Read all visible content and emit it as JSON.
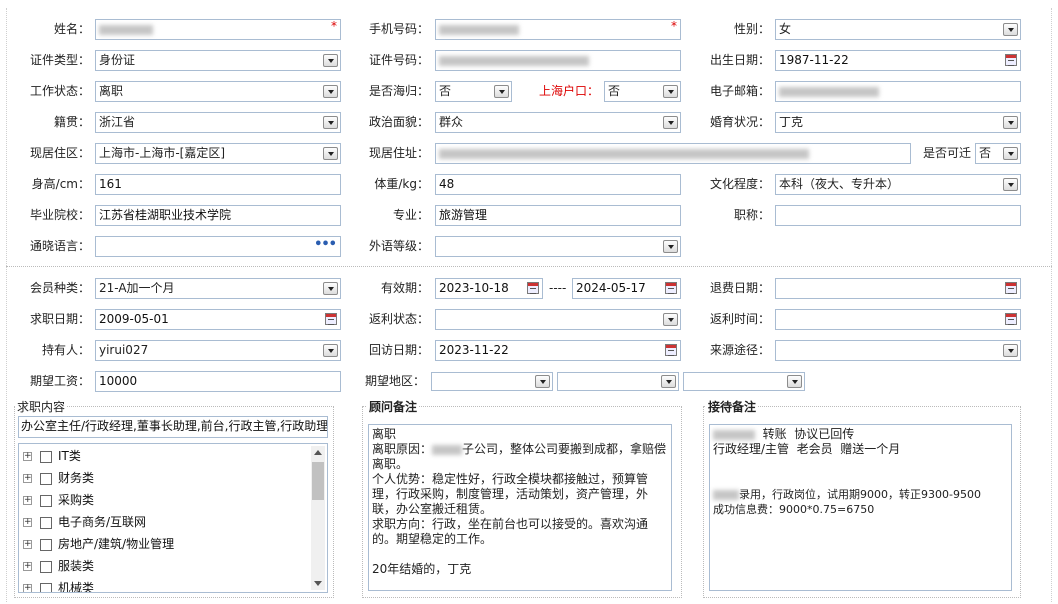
{
  "personal": {
    "name_label": "姓名：",
    "name_required": "*",
    "phone_label": "手机号码：",
    "phone_required": "*",
    "gender_label": "性别：",
    "gender_value": "女",
    "id_type_label": "证件类型：",
    "id_type_value": "身份证",
    "id_number_label": "证件号码：",
    "birth_label": "出生日期：",
    "birth_value": "1987-11-22",
    "work_status_label": "工作状态：",
    "work_status_value": "离职",
    "returnee_label": "是否海归：",
    "returnee_value": "否",
    "hukou_label": "上海户口：",
    "hukou_value": "否",
    "email_label": "电子邮箱：",
    "native_label": "籍贯：",
    "native_value": "浙江省",
    "political_label": "政治面貌：",
    "political_value": "群众",
    "marital_label": "婚育状况：",
    "marital_value": "丁克",
    "district_label": "现居住区：",
    "district_value": "上海市-上海市-[嘉定区]",
    "address_label": "现居住址：",
    "relocate_label": "是否可迁",
    "relocate_value": "否",
    "height_label": "身高/cm：",
    "height_value": "161",
    "weight_label": "体重/kg：",
    "weight_value": "48",
    "education_label": "文化程度：",
    "education_value": "本科（夜大、专升本）",
    "school_label": "毕业院校：",
    "school_value": "江苏省桂湖职业技术学院",
    "major_label": "专业：",
    "major_value": "旅游管理",
    "title_label": "职称：",
    "language_label": "通晓语言：",
    "language_more": "•••",
    "foreign_label": "外语等级："
  },
  "membership": {
    "member_type_label": "会员种类：",
    "member_type_value": "21-A加一个月",
    "valid_label": "有效期：",
    "valid_from": "2023-10-18",
    "valid_dash": "----",
    "valid_to": "2024-05-17",
    "refund_date_label": "退费日期：",
    "job_date_label": "求职日期：",
    "job_date_value": "2009-05-01",
    "rebate_status_label": "返利状态：",
    "rebate_time_label": "返利时间：",
    "holder_label": "持有人：",
    "holder_value": "yirui027",
    "visit_date_label": "回访日期：",
    "visit_date_value": "2023-11-22",
    "source_label": "来源途径：",
    "salary_label": "期望工资：",
    "salary_value": "10000",
    "region_label": "期望地区："
  },
  "job_panel": {
    "title": "求职内容",
    "summary": "办公室主任/行政经理,董事长助理,前台,行政主管,行政助理",
    "categories": [
      "IT类",
      "财务类",
      "采购类",
      "电子商务/互联网",
      "房地产/建筑/物业管理",
      "服装类",
      "机械类"
    ]
  },
  "advisor_panel": {
    "title": "顾问备注",
    "line1": "离职",
    "line2_prefix": "离职原因：",
    "line2_suffix": "子公司，整体公司要搬到成都，拿赔偿离职。",
    "line3": "个人优势：稳定性好，行政全模块都接触过，预算管理，行政采购，制度管理，活动策划，资产管理，外联，办公室搬迁租赁。",
    "line4": "求职方向：行政，坐在前台也可以接受的。喜欢沟通的。期望稳定的工作。",
    "line5": "20年结婚的，丁克"
  },
  "reception_panel": {
    "title": "接待备注",
    "line1_suffix": "转账  协议已回传",
    "line2": "行政经理/主管  老会员  赠送一个月",
    "line3_suffix": "录用，行政岗位，试用期9000，转正9300-9500",
    "line4": "成功信息费：9000*0.75=6750"
  },
  "icons": {
    "dropdown": "chevron-down-icon",
    "calendar": "calendar-icon",
    "expand": "plus-icon",
    "checkbox": "checkbox-icon"
  },
  "colors": {
    "required": "#dd0000",
    "input_border": "#a9bcd2",
    "link_blue": "#2a5db0"
  }
}
